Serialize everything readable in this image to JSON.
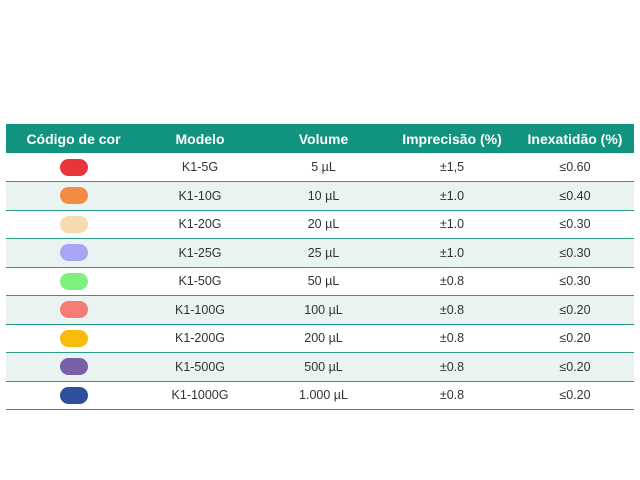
{
  "table": {
    "headers": [
      "Código de cor",
      "Modelo",
      "Volume",
      "Imprecisão (%)",
      "Inexatidão (%)"
    ],
    "rows": [
      {
        "color": "#e8343a",
        "model": "K1-5G",
        "volume": "5 µL",
        "imprecision": "±1,5",
        "inaccuracy": "≤0.60"
      },
      {
        "color": "#f28c45",
        "model": "K1-10G",
        "volume": "10 µL",
        "imprecision": "±1.0",
        "inaccuracy": "≤0.40"
      },
      {
        "color": "#f7dbb0",
        "model": "K1-20G",
        "volume": "20 µL",
        "imprecision": "±1.0",
        "inaccuracy": "≤0.30"
      },
      {
        "color": "#a9a4f3",
        "model": "K1-25G",
        "volume": "25 µL",
        "imprecision": "±1.0",
        "inaccuracy": "≤0.30"
      },
      {
        "color": "#7ef07e",
        "model": "K1-50G",
        "volume": "50 µL",
        "imprecision": "±0.8",
        "inaccuracy": "≤0.30"
      },
      {
        "color": "#f47c72",
        "model": "K1-100G",
        "volume": "100 µL",
        "imprecision": "±0.8",
        "inaccuracy": "≤0.20"
      },
      {
        "color": "#f7bb0c",
        "model": "K1-200G",
        "volume": "200 µL",
        "imprecision": "±0.8",
        "inaccuracy": "≤0.20"
      },
      {
        "color": "#7b5ea8",
        "model": "K1-500G",
        "volume": "500 µL",
        "imprecision": "±0.8",
        "inaccuracy": "≤0.20"
      },
      {
        "color": "#2d4f9c",
        "model": "K1-1000G",
        "volume": "1.000 µL",
        "imprecision": "±0.8",
        "inaccuracy": "≤0.20"
      }
    ]
  },
  "colors": {
    "header_bg": "#12937f",
    "row_alt_bg": "#e9f3f1",
    "row_border": "#2a9d8a"
  }
}
